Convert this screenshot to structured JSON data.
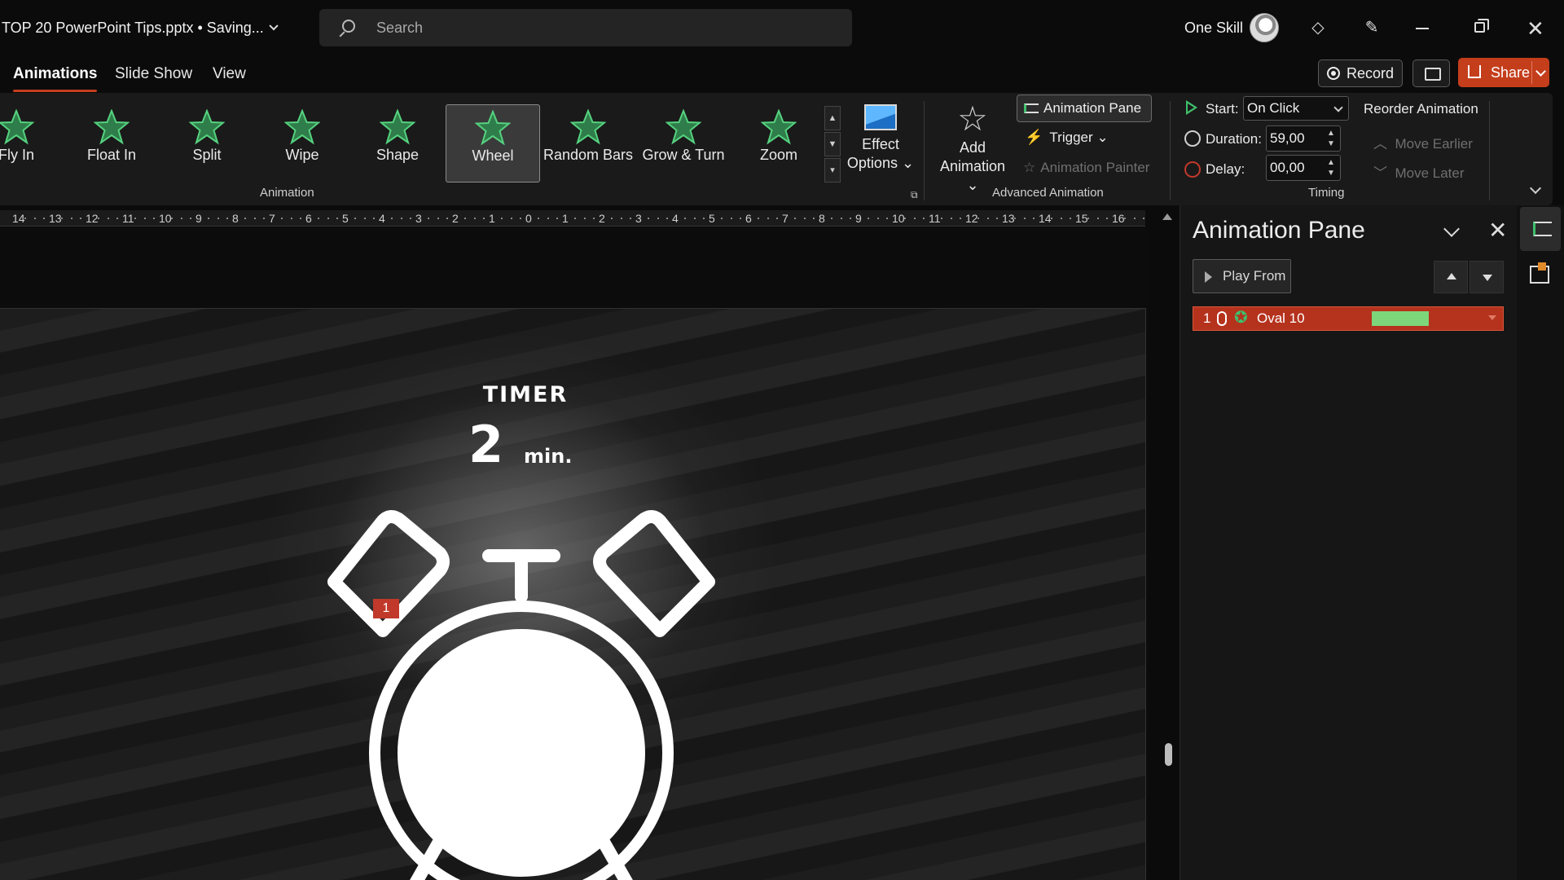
{
  "titlebar": {
    "doc_title": "TOP 20 PowerPoint Tips.pptx • Saving...",
    "search_placeholder": "Search",
    "user_name": "One Skill",
    "icons": [
      "diamond-icon",
      "pen-icon",
      "minimize-icon",
      "restore-icon",
      "close-icon"
    ]
  },
  "tabs": {
    "animations": "Animations",
    "slide_show": "Slide Show",
    "view": "View"
  },
  "header_actions": {
    "record": "Record",
    "share": "Share"
  },
  "ribbon": {
    "effects": [
      {
        "label": "Fly In",
        "selected": false
      },
      {
        "label": "Float In",
        "selected": false
      },
      {
        "label": "Split",
        "selected": false
      },
      {
        "label": "Wipe",
        "selected": false
      },
      {
        "label": "Shape",
        "selected": false
      },
      {
        "label": "Wheel",
        "selected": true
      },
      {
        "label": "Random Bars",
        "selected": false
      },
      {
        "label": "Grow & Turn",
        "selected": false
      },
      {
        "label": "Zoom",
        "selected": false
      }
    ],
    "effect_options_line1": "Effect",
    "effect_options_line2": "Options",
    "animation_group": "Animation",
    "add_animation_line1": "Add",
    "add_animation_line2": "Animation",
    "animation_pane": "Animation Pane",
    "trigger": "Trigger",
    "animation_painter": "Animation Painter",
    "advanced_group": "Advanced Animation",
    "start_label": "Start:",
    "start_value": "On Click",
    "duration_label": "Duration:",
    "duration_value": "59,00",
    "delay_label": "Delay:",
    "delay_value": "00,00",
    "timing_group": "Timing",
    "reorder_label": "Reorder Animation",
    "move_earlier": "Move Earlier",
    "move_later": "Move Later",
    "accent_color": "#3fbf6a"
  },
  "ruler": {
    "ticks": [
      "14",
      "13",
      "12",
      "11",
      "10",
      "9",
      "8",
      "7",
      "6",
      "5",
      "4",
      "3",
      "2",
      "1",
      "0",
      "1",
      "2",
      "3",
      "4",
      "5",
      "6",
      "7",
      "8",
      "9",
      "10",
      "11",
      "12",
      "13",
      "14",
      "15",
      "16"
    ]
  },
  "slide": {
    "timer_title": "TIMER",
    "timer_value": "2",
    "timer_unit": "min.",
    "animation_tag": "1"
  },
  "pane": {
    "title": "Animation Pane",
    "play_from": "Play From",
    "items": [
      {
        "number": "1",
        "name": "Oval 10",
        "bar_color": "#7ed67a",
        "row_color": "#b5321d"
      }
    ]
  }
}
